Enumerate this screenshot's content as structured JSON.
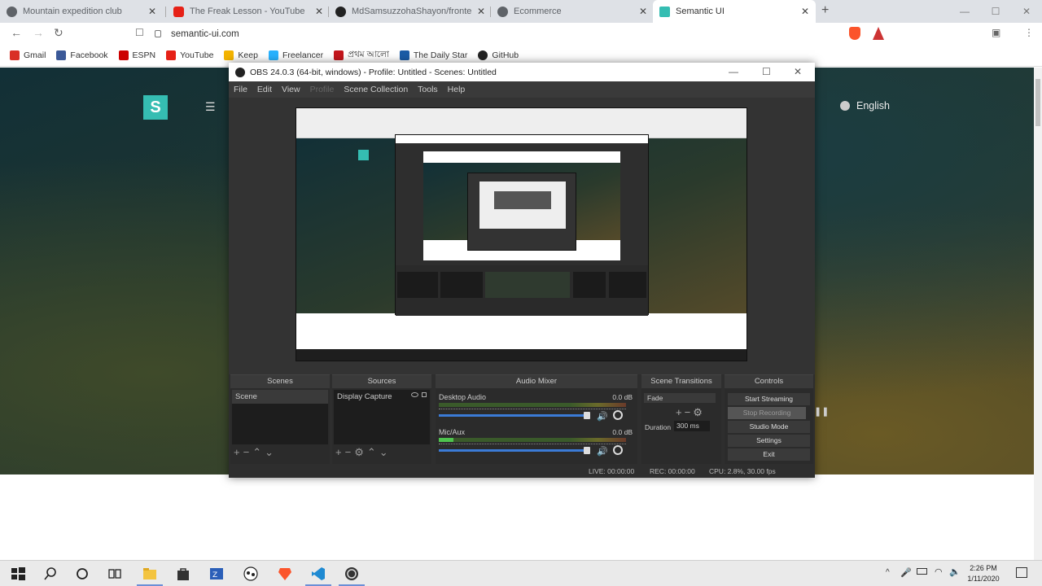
{
  "browser": {
    "tabs": [
      {
        "title": "Mountain expedition club",
        "favicon_color": "#5f6368"
      },
      {
        "title": "The Freak Lesson - YouTube",
        "favicon_color": "#e62117"
      },
      {
        "title": "MdSamsuzzohaShayon/frontend",
        "favicon_color": "#222222"
      },
      {
        "title": "Ecommerce",
        "favicon_color": "#5f6368"
      },
      {
        "title": "Semantic UI",
        "favicon_color": "#35bdb2"
      }
    ],
    "new_tab_label": "+",
    "url": "semantic-ui.com",
    "bookmarks": [
      {
        "label": "Gmail",
        "color": "#d93025"
      },
      {
        "label": "Facebook",
        "color": "#3b5998"
      },
      {
        "label": "ESPN",
        "color": "#cc0000"
      },
      {
        "label": "YouTube",
        "color": "#e62117"
      },
      {
        "label": "Keep",
        "color": "#f4b400"
      },
      {
        "label": "Freelancer",
        "color": "#29b2fe"
      },
      {
        "label": "প্রথম আলো",
        "color": "#c4161c"
      },
      {
        "label": "The Daily Star",
        "color": "#1a5ba6"
      },
      {
        "label": "GitHub",
        "color": "#222222"
      }
    ]
  },
  "site": {
    "logo_letter": "S",
    "language": "English",
    "accent": "#35bdb2"
  },
  "obs": {
    "title": "OBS 24.0.3 (64-bit, windows) - Profile: Untitled - Scenes: Untitled",
    "menu": [
      "File",
      "Edit",
      "View",
      "Profile",
      "Scene Collection",
      "Tools",
      "Help"
    ],
    "docks": {
      "scenes": {
        "title": "Scenes",
        "items": [
          "Scene"
        ]
      },
      "sources": {
        "title": "Sources",
        "items": [
          "Display Capture"
        ]
      },
      "mixer": {
        "title": "Audio Mixer",
        "channels": [
          {
            "name": "Desktop Audio",
            "db": "0.0 dB",
            "level": 0.0
          },
          {
            "name": "Mic/Aux",
            "db": "0.0 dB",
            "level": 0.08
          }
        ]
      },
      "transitions": {
        "title": "Scene Transitions",
        "selected": "Fade",
        "duration_label": "Duration",
        "duration_value": "300 ms"
      },
      "controls": {
        "title": "Controls",
        "buttons": [
          "Start Streaming",
          "Stop Recording",
          "Studio Mode",
          "Settings",
          "Exit"
        ]
      }
    },
    "status": {
      "live": "LIVE: 00:00:00",
      "rec": "REC: 00:00:00",
      "cpu": "CPU: 2.8%, 30.00 fps"
    }
  },
  "taskbar": {
    "time": "2:26 PM",
    "date": "1/11/2020",
    "icons": [
      "start-icon",
      "search-icon",
      "cortana-icon",
      "task-view-icon",
      "file-explorer-icon",
      "store-icon",
      "unknown-blue-icon",
      "game-icon",
      "brave-icon",
      "vscode-icon",
      "obs-icon"
    ]
  }
}
